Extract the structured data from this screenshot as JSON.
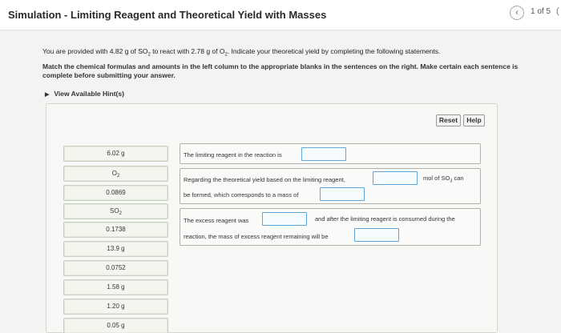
{
  "header": {
    "title": "Simulation - Limiting Reagent and Theoretical Yield with Masses",
    "back_icon": "chevron-left-icon",
    "page_count": "1 of 5",
    "edge_glyph": "("
  },
  "question": {
    "lead_parts": [
      "You are provided with 4.82 g of SO",
      "2",
      " to react with 2.78 g of O",
      "2",
      ". Indicate your theoretical yield by completing the following statements."
    ],
    "instruction": "Match the chemical formulas and amounts in the left column to the appropriate blanks in the sentences on the right. Make certain each sentence is complete before submitting your answer.",
    "hint_label": "View Available Hint(s)",
    "hint_icon": "triangle-right-icon"
  },
  "toolbar": {
    "reset_label": "Reset",
    "help_label": "Help"
  },
  "options": [
    {
      "base": "6.02 g",
      "sub": "",
      "tail": ""
    },
    {
      "base": "O",
      "sub": "2",
      "tail": ""
    },
    {
      "base": "0.0869",
      "sub": "",
      "tail": ""
    },
    {
      "base": "SO",
      "sub": "2",
      "tail": ""
    },
    {
      "base": "0.1738",
      "sub": "",
      "tail": ""
    },
    {
      "base": "13.9 g",
      "sub": "",
      "tail": ""
    },
    {
      "base": "0.0752",
      "sub": "",
      "tail": ""
    },
    {
      "base": "1.58 g",
      "sub": "",
      "tail": ""
    },
    {
      "base": "1.20 g",
      "sub": "",
      "tail": ""
    },
    {
      "base": "0.05 g",
      "sub": "",
      "tail": ""
    }
  ],
  "statements": {
    "s1": "The limiting reagent in the reaction is",
    "s2a": "Regarding the theoretical yield based on the limiting reagent,",
    "s2b_parts": [
      "mol of SO",
      "3",
      " can"
    ],
    "s2c": "be formed, which corresponds to a mass of",
    "s3a": "The excess reagent was",
    "s3b": "and after the limiting reagent is consumed during the",
    "s3c": "reaction, the mass of excess reagent remaining will be"
  }
}
